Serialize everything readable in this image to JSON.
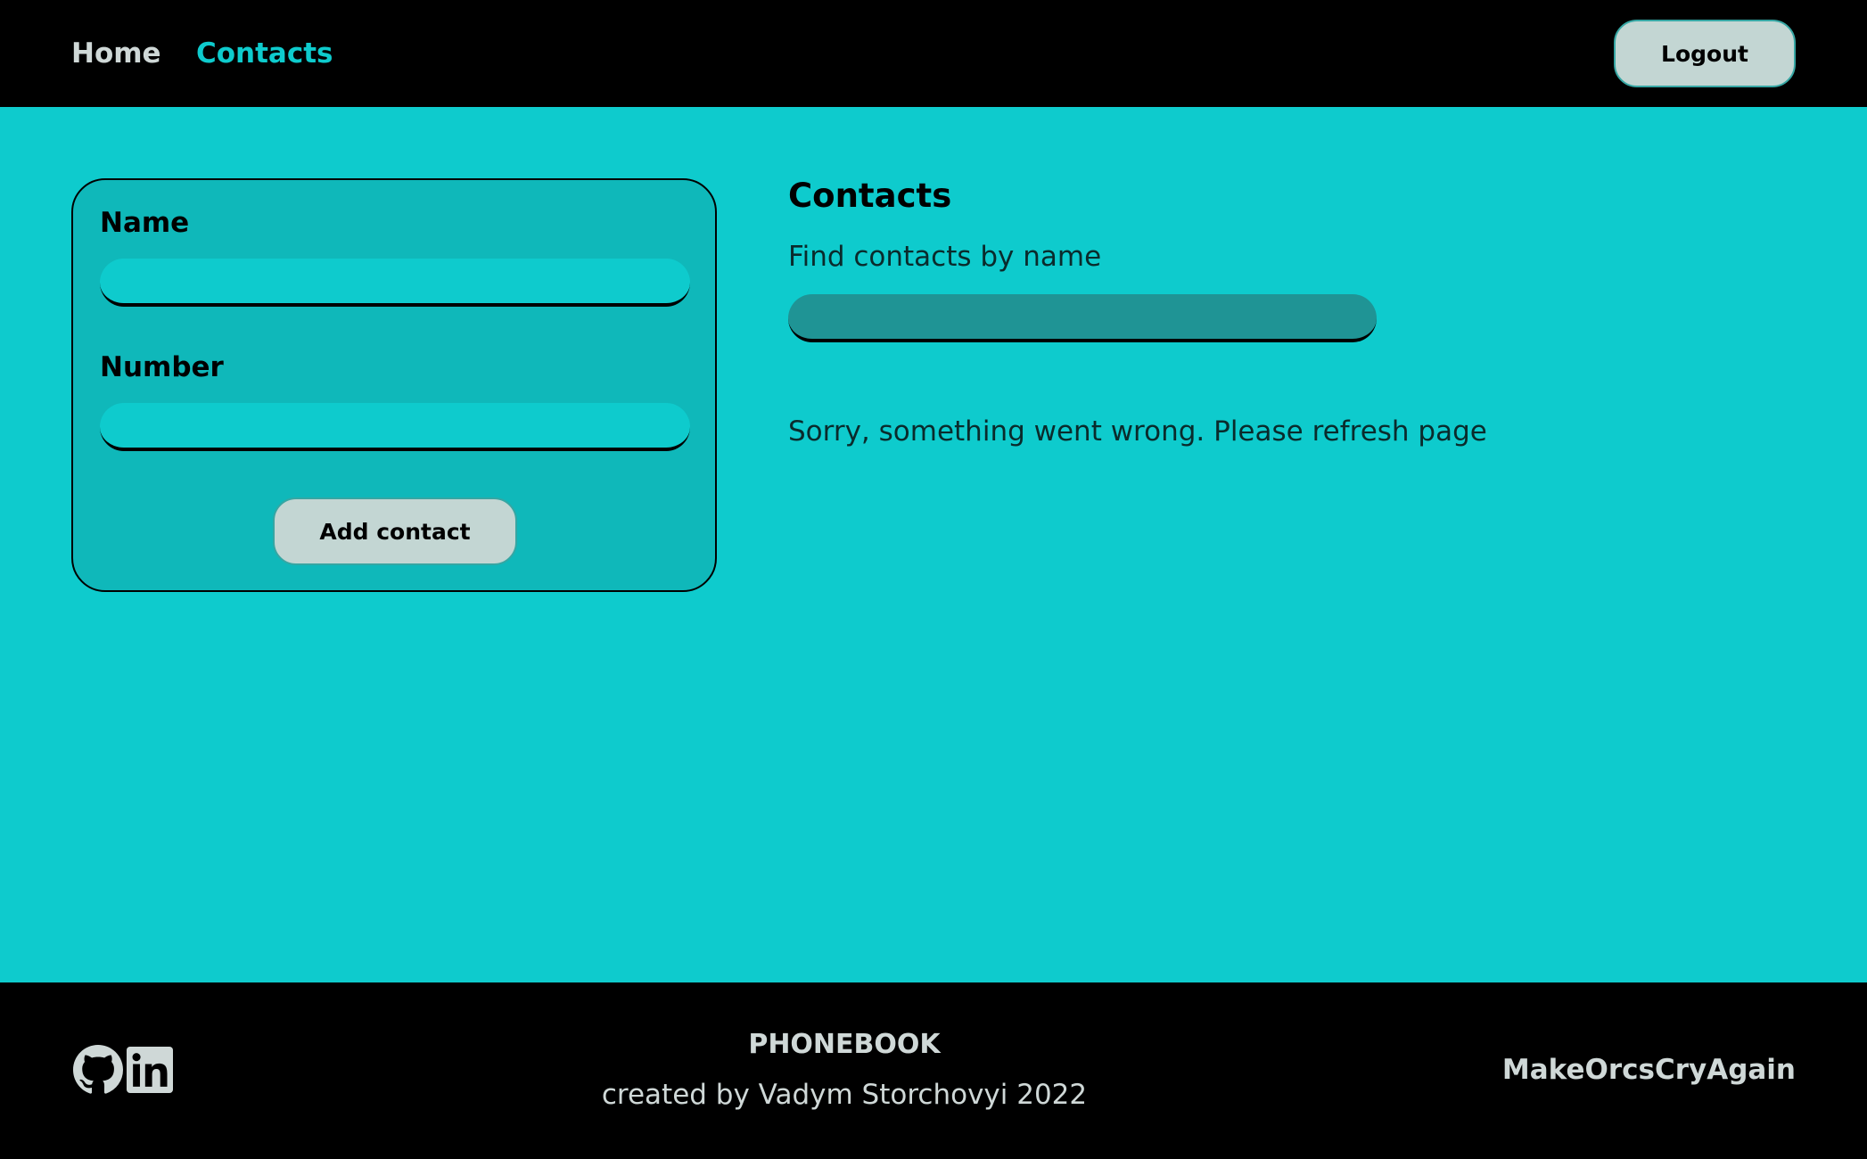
{
  "header": {
    "nav": [
      {
        "label": "Home",
        "active": false
      },
      {
        "label": "Contacts",
        "active": true
      }
    ],
    "logout_label": "Logout"
  },
  "form": {
    "name_label": "Name",
    "name_value": "",
    "number_label": "Number",
    "number_value": "",
    "submit_label": "Add contact"
  },
  "contacts": {
    "title": "Contacts",
    "filter_label": "Find contacts by name",
    "filter_value": "",
    "error_message": "Sorry, something went wrong. Please refresh page"
  },
  "footer": {
    "icons": [
      "github-icon",
      "linkedin-icon"
    ],
    "brand": "PHONEBOOK",
    "credit": "created by Vadym Storchovyi 2022",
    "slogan": "MakeOrcsCryAgain"
  },
  "colors": {
    "background": "#0ecbcd",
    "header_footer": "#000000",
    "form_card": "#0fb8ba",
    "filter_input": "#1f9495",
    "button": "#c3d6d3",
    "active_nav": "#0ecbcd",
    "footer_text": "#cfd8d7"
  }
}
